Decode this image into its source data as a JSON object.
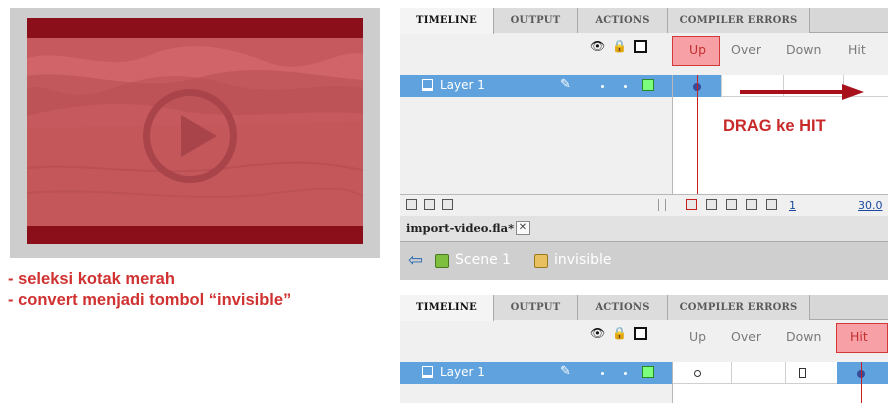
{
  "notes": [
    "- seleksi kotak merah",
    "- convert menjadi tombol “invisible”"
  ],
  "timeline_top": {
    "tabs": [
      "TIMELINE",
      "OUTPUT",
      "ACTIONS",
      "COMPILER ERRORS"
    ],
    "active_tab": "TIMELINE",
    "frames": [
      "Up",
      "Over",
      "Down",
      "Hit"
    ],
    "selected_frame": "Up",
    "layer_name": "Layer 1",
    "annotation": "DRAG ke HIT",
    "current_frame": "1",
    "fps": "30.0"
  },
  "document": {
    "tab_label": "import-video.fla*",
    "close_glyph": "✕"
  },
  "breadcrumb": {
    "scene": "Scene 1",
    "symbol": "invisible"
  },
  "timeline_bottom": {
    "tabs": [
      "TIMELINE",
      "OUTPUT",
      "ACTIONS",
      "COMPILER ERRORS"
    ],
    "active_tab": "TIMELINE",
    "frames": [
      "Up",
      "Over",
      "Down",
      "Hit"
    ],
    "selected_frame": "Hit",
    "layer_name": "Layer 1"
  },
  "icons": {
    "eye": "eye-icon",
    "lock": "lock-icon",
    "outline": "outline-square-icon",
    "pencil": "pencil-icon"
  },
  "colors": {
    "highlight_red": "#d03232",
    "video_overlay": "#c45a5e",
    "layer_selected": "#5fa2dd",
    "frame_selected": "#f7a1a6"
  }
}
